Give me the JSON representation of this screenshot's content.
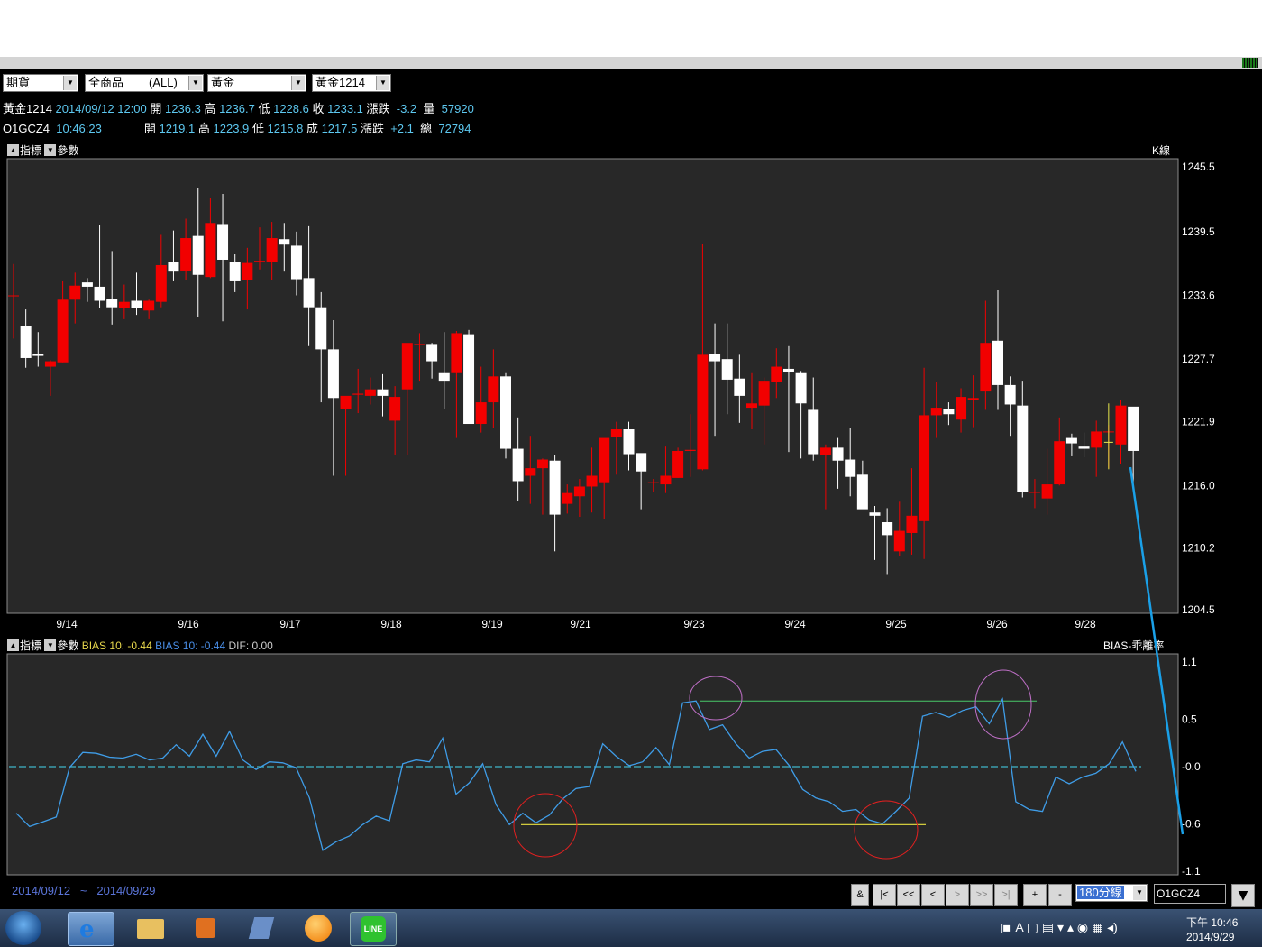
{
  "toolbar": {
    "selects": [
      "期貨",
      "全商品",
      "(ALL)",
      "黃金",
      "黃金1214"
    ]
  },
  "quote1": {
    "name": "黃金1214",
    "datetime": "2014/09/12 12:00",
    "open_label": "開",
    "open": "1236.3",
    "high_label": "高",
    "high": "1236.7",
    "low_label": "低",
    "low": "1228.6",
    "close_label": "收",
    "close": "1233.1",
    "chg_label": "漲跌",
    "chg": "-3.2",
    "vol_label": "量",
    "vol": "57920"
  },
  "quote2": {
    "name": "O1GCZ4",
    "time": "10:46:23",
    "open_label": "開",
    "open": "1219.1",
    "high_label": "高",
    "high": "1223.9",
    "low_label": "低",
    "low": "1215.8",
    "close_label": "成",
    "close": "1217.5",
    "chg_label": "漲跌",
    "chg": "+2.1",
    "vol_label": "總",
    "vol": "72794"
  },
  "panel_top": {
    "btn1": "指標",
    "btn2": "參數",
    "label": "K線"
  },
  "panel_bottom": {
    "btn1": "指標",
    "btn2": "參數",
    "bias1": "BIAS 10: -0.44",
    "bias2": "BIAS 10: -0.44",
    "dif": "DIF:   0.00",
    "label": "BIAS-乖離率"
  },
  "chart_data": [
    {
      "type": "candlestick",
      "y_ticks": [
        "1245.5",
        "1239.5",
        "1233.6",
        "1227.7",
        "1221.9",
        "1216.0",
        "1210.2",
        "1204.5"
      ],
      "ylim": [
        1204.5,
        1245.5
      ],
      "x_ticks": [
        "9/14",
        "9/16",
        "9/17",
        "9/18",
        "9/19",
        "9/21",
        "9/23",
        "9/24",
        "9/25",
        "9/26",
        "9/28"
      ],
      "ohlc": [
        [
          1233.6,
          1236.5,
          1229.6,
          1233.6
        ],
        [
          1230.8,
          1232.3,
          1226.9,
          1227.8
        ],
        [
          1228.2,
          1230.2,
          1227.0,
          1228.0
        ],
        [
          1227.0,
          1227.6,
          1224.3,
          1227.5
        ],
        [
          1227.4,
          1234.9,
          1227.4,
          1233.2
        ],
        [
          1233.2,
          1235.7,
          1231.0,
          1234.5
        ],
        [
          1234.8,
          1235.2,
          1233.0,
          1234.4
        ],
        [
          1234.4,
          1240.1,
          1232.4,
          1233.1
        ],
        [
          1233.3,
          1237.7,
          1230.9,
          1232.5
        ],
        [
          1232.4,
          1234.6,
          1231.4,
          1233.0
        ],
        [
          1233.1,
          1235.7,
          1231.8,
          1232.4
        ],
        [
          1232.2,
          1233.2,
          1231.4,
          1233.1
        ],
        [
          1233.0,
          1239.2,
          1232.5,
          1236.4
        ],
        [
          1236.7,
          1239.6,
          1234.9,
          1235.8
        ],
        [
          1235.9,
          1240.7,
          1235.0,
          1238.9
        ],
        [
          1239.1,
          1243.5,
          1231.6,
          1235.5
        ],
        [
          1235.3,
          1242.6,
          1235.2,
          1240.3
        ],
        [
          1240.2,
          1243.0,
          1231.2,
          1236.9
        ],
        [
          1236.7,
          1237.4,
          1233.9,
          1234.9
        ],
        [
          1235.0,
          1238.0,
          1232.3,
          1236.6
        ],
        [
          1236.8,
          1239.9,
          1236.0,
          1236.8
        ],
        [
          1236.7,
          1240.4,
          1235.0,
          1238.9
        ],
        [
          1238.8,
          1240.3,
          1235.8,
          1238.3
        ],
        [
          1238.2,
          1239.5,
          1233.6,
          1235.1
        ],
        [
          1235.2,
          1240.0,
          1228.9,
          1232.5
        ],
        [
          1232.5,
          1233.9,
          1223.7,
          1228.6
        ],
        [
          1228.6,
          1231.3,
          1216.9,
          1224.1
        ],
        [
          1223.1,
          1224.1,
          1216.9,
          1224.3
        ],
        [
          1224.4,
          1226.8,
          1222.7,
          1224.5
        ],
        [
          1224.3,
          1226.0,
          1223.5,
          1224.9
        ],
        [
          1224.9,
          1226.3,
          1222.4,
          1224.3
        ],
        [
          1222.0,
          1225.2,
          1218.8,
          1224.2
        ],
        [
          1224.9,
          1228.4,
          1218.8,
          1229.2
        ],
        [
          1229.0,
          1230.1,
          1225.7,
          1229.1
        ],
        [
          1229.1,
          1229.2,
          1225.9,
          1227.5
        ],
        [
          1226.4,
          1230.2,
          1223.1,
          1225.7
        ],
        [
          1226.4,
          1230.3,
          1220.4,
          1230.1
        ],
        [
          1230.0,
          1230.4,
          1221.8,
          1221.7
        ],
        [
          1221.7,
          1227.0,
          1220.9,
          1223.7
        ],
        [
          1223.7,
          1228.6,
          1221.3,
          1226.1
        ],
        [
          1226.1,
          1226.4,
          1218.5,
          1219.4
        ],
        [
          1219.4,
          1222.3,
          1214.6,
          1216.4
        ],
        [
          1216.9,
          1220.6,
          1214.3,
          1217.6
        ],
        [
          1217.6,
          1218.5,
          1213.3,
          1218.4
        ],
        [
          1218.3,
          1218.8,
          1209.9,
          1213.3
        ],
        [
          1214.3,
          1216.1,
          1213.4,
          1215.3
        ],
        [
          1215.0,
          1216.6,
          1213.1,
          1215.9
        ],
        [
          1215.9,
          1219.5,
          1213.5,
          1216.9
        ],
        [
          1216.3,
          1218.0,
          1212.9,
          1220.4
        ],
        [
          1220.5,
          1221.9,
          1217.0,
          1221.2
        ],
        [
          1221.2,
          1221.9,
          1217.4,
          1218.9
        ],
        [
          1219.0,
          1218.8,
          1213.8,
          1217.3
        ],
        [
          1216.2,
          1216.6,
          1215.4,
          1216.3
        ],
        [
          1216.1,
          1219.6,
          1215.3,
          1216.9
        ],
        [
          1216.7,
          1219.5,
          1216.7,
          1219.2
        ],
        [
          1219.2,
          1222.6,
          1216.8,
          1219.3
        ],
        [
          1217.5,
          1238.4,
          1217.4,
          1228.1
        ],
        [
          1228.2,
          1231.0,
          1220.6,
          1227.5
        ],
        [
          1227.7,
          1231.0,
          1222.6,
          1225.8
        ],
        [
          1225.9,
          1228.1,
          1221.8,
          1224.3
        ],
        [
          1223.2,
          1226.4,
          1221.2,
          1223.6
        ],
        [
          1223.4,
          1226.0,
          1219.8,
          1225.7
        ],
        [
          1225.6,
          1228.7,
          1224.1,
          1227.0
        ],
        [
          1226.8,
          1228.9,
          1219.1,
          1226.5
        ],
        [
          1226.4,
          1226.6,
          1218.5,
          1223.6
        ],
        [
          1223.0,
          1226.0,
          1218.3,
          1218.9
        ],
        [
          1218.8,
          1219.8,
          1213.8,
          1219.5
        ],
        [
          1219.5,
          1220.4,
          1215.7,
          1218.3
        ],
        [
          1218.4,
          1221.3,
          1215.0,
          1216.8
        ],
        [
          1217.0,
          1218.3,
          1213.9,
          1213.8
        ],
        [
          1213.5,
          1214.1,
          1209.1,
          1213.2
        ],
        [
          1212.6,
          1213.9,
          1207.8,
          1211.4
        ],
        [
          1209.9,
          1214.5,
          1209.5,
          1211.8
        ],
        [
          1211.6,
          1217.6,
          1209.6,
          1213.2
        ],
        [
          1212.7,
          1226.9,
          1209.2,
          1222.5
        ],
        [
          1222.5,
          1225.6,
          1220.4,
          1223.2
        ],
        [
          1223.1,
          1223.7,
          1221.6,
          1222.6
        ],
        [
          1222.1,
          1225.0,
          1220.9,
          1224.2
        ],
        [
          1223.9,
          1226.2,
          1221.4,
          1224.1
        ],
        [
          1224.7,
          1233.1,
          1223.0,
          1229.2
        ],
        [
          1229.4,
          1234.1,
          1223.0,
          1225.3
        ],
        [
          1225.3,
          1226.1,
          1220.6,
          1223.5
        ],
        [
          1223.4,
          1225.7,
          1214.9,
          1215.4
        ],
        [
          1215.4,
          1216.6,
          1213.9,
          1215.4
        ],
        [
          1214.8,
          1219.4,
          1213.3,
          1216.1
        ],
        [
          1216.1,
          1222.3,
          1216.0,
          1220.1
        ],
        [
          1220.4,
          1220.8,
          1218.7,
          1219.9
        ],
        [
          1219.6,
          1220.9,
          1218.6,
          1219.4
        ],
        [
          1219.5,
          1222.0,
          1216.8,
          1221.0
        ],
        [
          1221.0,
          1221.6,
          1217.6,
          1221.0
        ],
        [
          1219.8,
          1223.9,
          1218.0,
          1223.4
        ],
        [
          1223.3,
          1222.9,
          1216.3,
          1219.2
        ]
      ]
    },
    {
      "type": "line",
      "y_ticks": [
        "1.1",
        "0.5",
        "-0.0",
        "-0.6",
        "-1.1"
      ],
      "ylim": [
        -1.1,
        1.1
      ],
      "series": [
        {
          "values": [
            -0.49,
            -0.63,
            -0.58,
            -0.53,
            -0.01,
            0.15,
            0.14,
            0.1,
            0.09,
            0.13,
            0.07,
            0.09,
            0.23,
            0.11,
            0.34,
            0.11,
            0.37,
            0.07,
            -0.03,
            0.05,
            0.04,
            -0.01,
            -0.33,
            -0.88,
            -0.79,
            -0.73,
            -0.61,
            -0.52,
            -0.57,
            0.03,
            0.07,
            0.05,
            0.3,
            -0.29,
            -0.17,
            0.03,
            -0.4,
            -0.61,
            -0.49,
            -0.59,
            -0.51,
            -0.34,
            -0.23,
            -0.21,
            0.24,
            0.11,
            0.01,
            0.05,
            0.2,
            0.02,
            0.67,
            0.69,
            0.39,
            0.44,
            0.24,
            0.09,
            0.16,
            0.18,
            0.01,
            -0.24,
            -0.33,
            -0.37,
            -0.47,
            -0.45,
            -0.56,
            -0.6,
            -0.47,
            -0.33,
            0.53,
            0.57,
            0.52,
            0.59,
            0.63,
            0.45,
            0.71,
            -0.37,
            -0.45,
            -0.47,
            -0.11,
            -0.18,
            -0.11,
            -0.07,
            0.03,
            0.26,
            -0.05
          ]
        }
      ]
    }
  ],
  "annotations": {
    "green_line_value": 0.69,
    "yellow_line_value": -0.61
  },
  "footer": {
    "date_from": "2014/09/12",
    "tilde": "~",
    "date_to": "2014/09/29"
  },
  "nav": {
    "buttons": [
      "&",
      "|<",
      "<<",
      "<",
      ">",
      ">>",
      ">|",
      "+",
      "-"
    ],
    "period": "180分線",
    "symbol": "O1GCZ4"
  },
  "tray": {
    "time": "下午 10:46",
    "date": "2014/9/29"
  },
  "colors": {
    "up": "#f20000",
    "down": "#ffffff",
    "bias": "#3f9de8",
    "zero": "#3eb4c8",
    "bg": "#282828"
  }
}
